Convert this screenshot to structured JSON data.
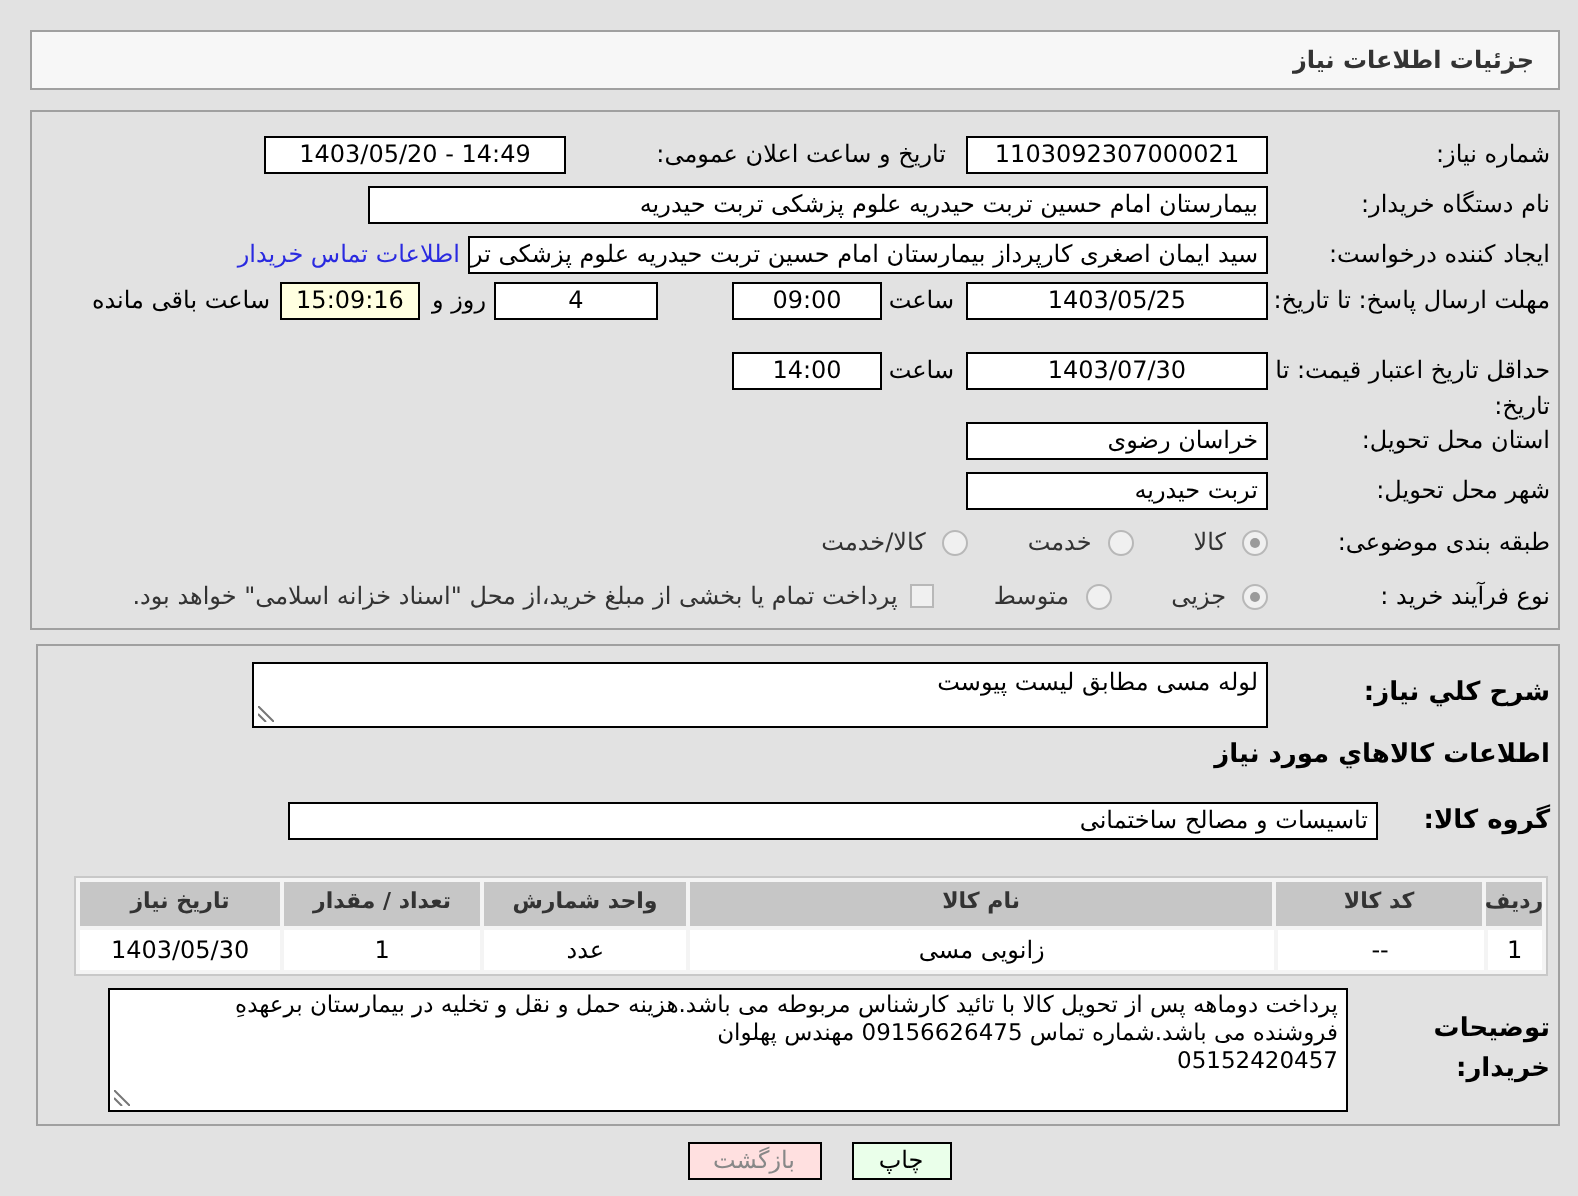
{
  "header": {
    "title": "جزئیات اطلاعات نیاز"
  },
  "need_number": {
    "label": "شماره نیاز:",
    "value": "1103092307000021"
  },
  "announce": {
    "label": "تاریخ و ساعت اعلان عمومی:",
    "value": "1403/05/20 - 14:49"
  },
  "buyer_org": {
    "label": "نام دستگاه خریدار:",
    "value": "بیمارستان امام حسین تربت حیدریه   علوم پزشکی تربت حیدریه"
  },
  "requester": {
    "label": "ایجاد کننده درخواست:",
    "value": "سید ایمان اصغری کارپرداز بیمارستان امام حسین تربت حیدریه   علوم پزشکی تر",
    "link": "اطلاعات تماس خریدار"
  },
  "reply_deadline": {
    "label": "مهلت ارسال پاسخ: تا تاریخ:",
    "date": "1403/05/25",
    "time_label": "ساعت",
    "time": "09:00",
    "days": "4",
    "days_label": "روز و",
    "remaining": "15:09:16",
    "remaining_label": "ساعت باقی مانده"
  },
  "price_validity": {
    "label": "حداقل تاریخ اعتبار قیمت: تا تاریخ:",
    "date": "1403/07/30",
    "time_label": "ساعت",
    "time": "14:00"
  },
  "province": {
    "label": "استان محل تحویل:",
    "value": "خراسان رضوی"
  },
  "city": {
    "label": "شهر محل تحویل:",
    "value": "تربت حیدریه"
  },
  "category": {
    "label": "طبقه بندی موضوعی:",
    "options": [
      {
        "label": "کالا",
        "selected": true
      },
      {
        "label": "خدمت",
        "selected": false
      },
      {
        "label": "کالا/خدمت",
        "selected": false
      }
    ]
  },
  "purchase_process": {
    "label": "نوع فرآیند خرید :",
    "options": [
      {
        "label": "جزیی",
        "selected": true
      },
      {
        "label": "متوسط",
        "selected": false
      }
    ],
    "checkbox": {
      "label": "پرداخت تمام یا بخشی از مبلغ خرید،از محل \"اسناد خزانه اسلامی\" خواهد بود.",
      "checked": false
    }
  },
  "description": {
    "label": "شرح کلي نياز:",
    "value": "لوله مسی مطابق لیست پیوست"
  },
  "goods_title": "اطلاعات کالاهاي مورد نياز",
  "goods_group": {
    "label": "گروه کالا:",
    "value": "تاسیسات و مصالح ساختمانی"
  },
  "table": {
    "columns": [
      "ردیف",
      "کد کالا",
      "نام کالا",
      "واحد شمارش",
      "تعداد / مقدار",
      "تاریخ نیاز"
    ],
    "rows": [
      [
        "1",
        "--",
        "زانویی مسی",
        "عدد",
        "1",
        "1403/05/30"
      ]
    ]
  },
  "buyer_notes": {
    "label": "توضیحات خریدار:",
    "lines": [
      "پرداخت دوماهه پس از تحویل کالا با تائید کارشناس مربوطه می باشد.هزینه حمل و نقل و تخلیه در بیمارستان برعهدهِ",
      "فروشنده می باشد.شماره تماس 09156626475 مهندس پهلوان",
      "05152420457"
    ]
  },
  "buttons": [
    {
      "label": "چاپ",
      "kind": "print"
    },
    {
      "label": "بازگشت",
      "kind": "back"
    }
  ]
}
